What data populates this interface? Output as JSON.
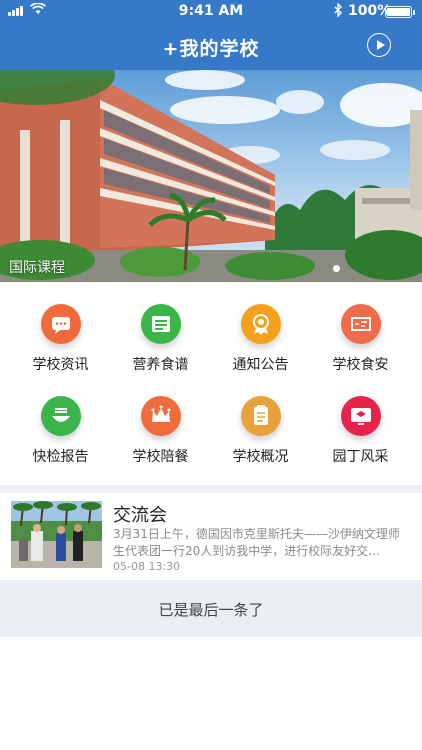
{
  "status_bar": {
    "time": "9:41 AM",
    "battery": "100%",
    "battery_level": 1.0,
    "icons": [
      "signal-icon",
      "wifi-icon",
      "bluetooth-icon",
      "battery-icon"
    ]
  },
  "nav": {
    "title": "+我的学校",
    "action_icon": "play-icon"
  },
  "banner": {
    "caption": "国际课程",
    "page_index": 1
  },
  "menu": [
    {
      "label": "学校资讯",
      "icon": "message-icon",
      "color": "#f2693c"
    },
    {
      "label": "营养食谱",
      "icon": "recipe-icon",
      "color": "#39b54a"
    },
    {
      "label": "通知公告",
      "icon": "notice-icon",
      "color": "#f5a11c"
    },
    {
      "label": "学校食安",
      "icon": "food-safety-icon",
      "color": "#f06b4a"
    },
    {
      "label": "快检报告",
      "icon": "report-icon",
      "color": "#3bb54b"
    },
    {
      "label": "学校陪餐",
      "icon": "crown-icon",
      "color": "#f26b3d"
    },
    {
      "label": "学校概况",
      "icon": "clipboard-icon",
      "color": "#e9a23b"
    },
    {
      "label": "园丁风采",
      "icon": "monitor-icon",
      "color": "#e8234a"
    }
  ],
  "news": [
    {
      "title": "交流会",
      "summary": "3月31日上午，德国因市克里斯托夫——沙伊纳文理师生代表团一行20人到访我中学，进行校际友好交…",
      "date": "05-08 13:30"
    }
  ],
  "footer": {
    "end_text": "已是最后一条了"
  },
  "colors": {
    "primary": "#3579c8",
    "background_gray": "#ebeef2"
  }
}
